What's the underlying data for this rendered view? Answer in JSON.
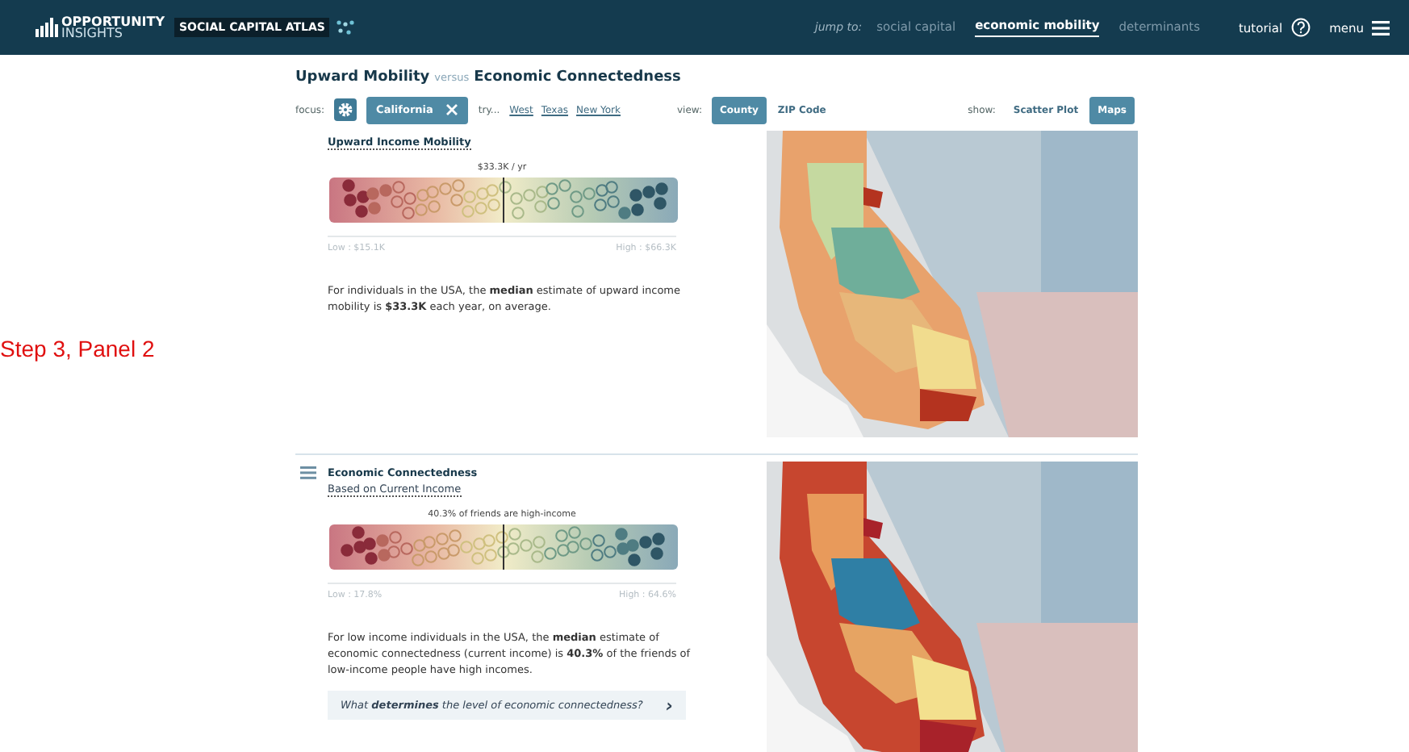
{
  "header": {
    "logo": {
      "line1": "OPPORTUNITY",
      "line2": "INSIGHTS"
    },
    "atlas_title": "SOCIAL CAPITAL ATLAS",
    "jump_label": "jump to:",
    "jump_links": [
      {
        "label": "social capital",
        "selected": false
      },
      {
        "label": "economic mobility",
        "selected": true
      },
      {
        "label": "determinants",
        "selected": false
      }
    ],
    "tutorial": "tutorial",
    "menu": "menu"
  },
  "heading": {
    "primary": "Upward Mobility",
    "connector": "versus",
    "secondary": "Economic Connectedness"
  },
  "controls": {
    "focus_label": "focus:",
    "focus_chip": "California",
    "try_label": "try...",
    "try_links": [
      "West",
      "Texas",
      "New York"
    ],
    "view_label": "view:",
    "view_options": [
      {
        "label": "County",
        "selected": true
      },
      {
        "label": "ZIP Code",
        "selected": false
      }
    ],
    "show_label": "show:",
    "show_options": [
      {
        "label": "Scatter Plot",
        "selected": false
      },
      {
        "label": "Maps",
        "selected": true
      }
    ]
  },
  "side_note": "Step 3, Panel 2",
  "panels": [
    {
      "title": "Upward Income Mobility",
      "median_label": "$33.3K / yr",
      "low": "Low : $15.1K",
      "high": "High : $66.3K",
      "description": "For individuals in the USA, the **median** estimate of upward income mobility is **$33.3K** each year, on average."
    },
    {
      "title": "Economic Connectedness",
      "subtitle": "Based on Current Income",
      "median_label": "40.3% of friends are high-income",
      "low": "Low : 17.8%",
      "high": "High : 64.6%",
      "description": "For low income individuals in the USA, the **median** estimate of economic connectedness (current income) is **40.3%** of the friends of low-income people have high incomes.",
      "question": "What **determines** the level of economic connectedness?",
      "question_arrow": "›"
    }
  ]
}
